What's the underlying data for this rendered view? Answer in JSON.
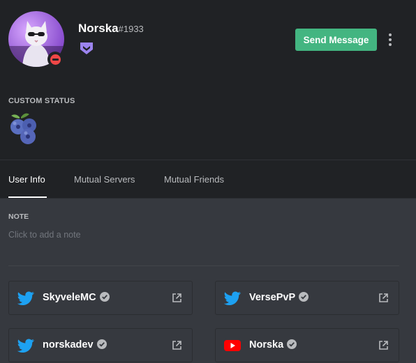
{
  "profile": {
    "username": "Norska",
    "discriminator": "#1933",
    "status": "do-not-disturb",
    "badge_icon": "hypesquad-icon",
    "badge_color": "#9c84ef"
  },
  "actions": {
    "send_message_label": "Send Message",
    "send_message_color": "#43b581",
    "more_icon": "more-vertical-icon"
  },
  "custom_status": {
    "label": "CUSTOM STATUS",
    "emoji": "blueberries"
  },
  "tabs": [
    {
      "label": "User Info",
      "active": true
    },
    {
      "label": "Mutual Servers",
      "active": false
    },
    {
      "label": "Mutual Friends",
      "active": false
    }
  ],
  "note": {
    "label": "NOTE",
    "placeholder": "Click to add a note"
  },
  "connected_accounts": [
    {
      "platform": "twitter",
      "name": "SkyveleMC",
      "verified": true
    },
    {
      "platform": "twitter",
      "name": "VersePvP",
      "verified": true
    },
    {
      "platform": "twitter",
      "name": "norskadev",
      "verified": true
    },
    {
      "platform": "youtube",
      "name": "Norska",
      "verified": true
    }
  ]
}
